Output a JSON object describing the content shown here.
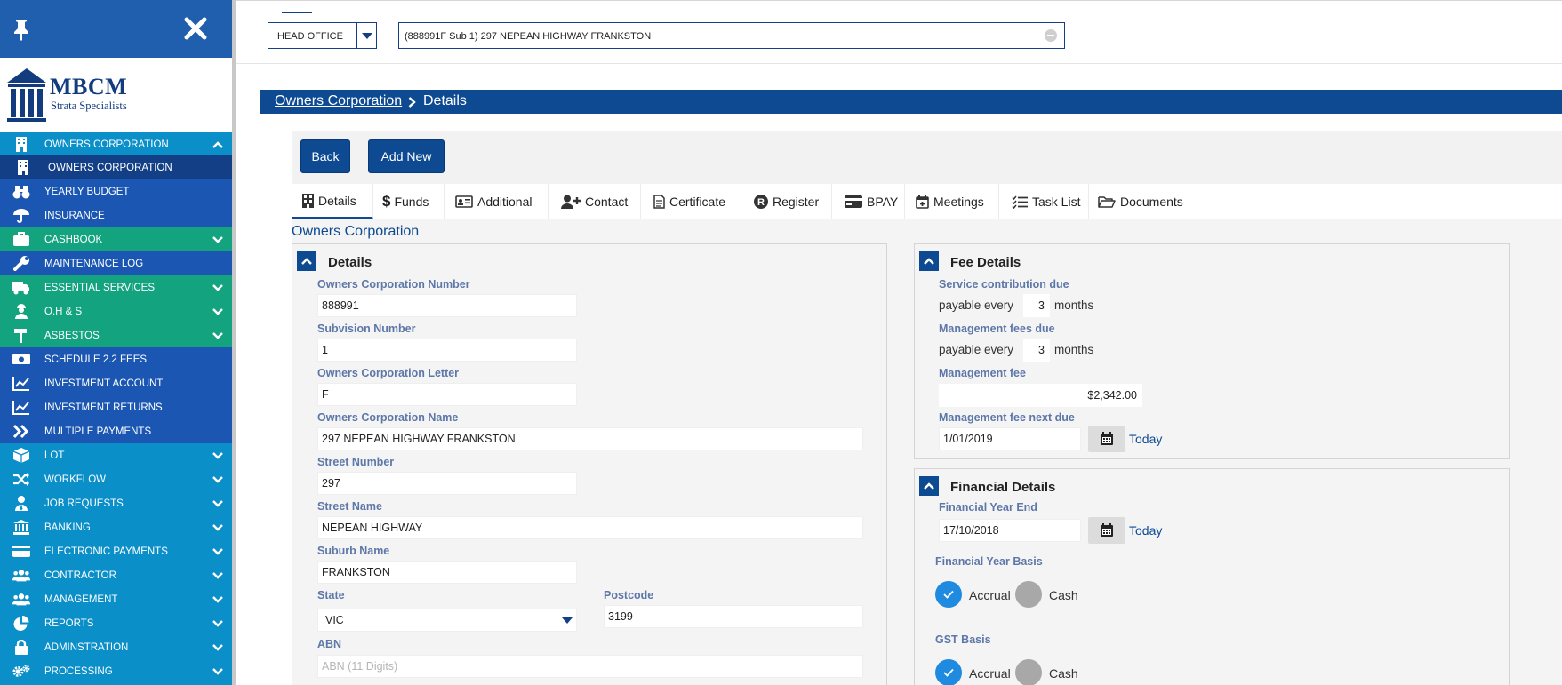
{
  "sidebar": {
    "logo_title": "MBCM",
    "logo_subtitle": "Strata Specialists",
    "items": [
      {
        "label": "OWNERS CORPORATION",
        "icon": "building-icon"
      },
      {
        "label": "OWNERS CORPORATION",
        "icon": "building-icon"
      },
      {
        "label": "YEARLY BUDGET",
        "icon": "binoculars-icon"
      },
      {
        "label": "INSURANCE",
        "icon": "umbrella-icon"
      },
      {
        "label": "CASHBOOK",
        "icon": "briefcase-icon"
      },
      {
        "label": "MAINTENANCE LOG",
        "icon": "wrench-icon"
      },
      {
        "label": "ESSENTIAL SERVICES",
        "icon": "truck-icon"
      },
      {
        "label": "O.H & S",
        "icon": "worker-icon"
      },
      {
        "label": "ASBESTOS",
        "icon": "sign-icon"
      },
      {
        "label": "SCHEDULE 2.2 FEES",
        "icon": "money-icon"
      },
      {
        "label": "INVESTMENT ACCOUNT",
        "icon": "chart-line-icon"
      },
      {
        "label": "INVESTMENT RETURNS",
        "icon": "chart-line-icon"
      },
      {
        "label": "MULTIPLE PAYMENTS",
        "icon": "double-chevron-icon"
      },
      {
        "label": "LOT",
        "icon": "cube-icon"
      },
      {
        "label": "WORKFLOW",
        "icon": "shuffle-icon"
      },
      {
        "label": "JOB REQUESTS",
        "icon": "user-tie-icon"
      },
      {
        "label": "BANKING",
        "icon": "bank-icon"
      },
      {
        "label": "ELECTRONIC PAYMENTS",
        "icon": "credit-card-icon"
      },
      {
        "label": "CONTRACTOR",
        "icon": "users-icon"
      },
      {
        "label": "MANAGEMENT",
        "icon": "users-icon"
      },
      {
        "label": "REPORTS",
        "icon": "pie-chart-icon"
      },
      {
        "label": "ADMINSTRATION",
        "icon": "lock-icon"
      },
      {
        "label": "PROCESSING",
        "icon": "cogs-icon"
      }
    ]
  },
  "header": {
    "office": "HEAD OFFICE",
    "selected_oc": "(888991F Sub 1) 297 NEPEAN HIGHWAY FRANKSTON"
  },
  "breadcrumb": {
    "parent": "Owners Corporation",
    "current": "Details"
  },
  "actions": {
    "back": "Back",
    "add_new": "Add New"
  },
  "tabs": [
    "Details",
    "Funds",
    "Additional",
    "Contact",
    "Certificate",
    "Register",
    "BPAY",
    "Meetings",
    "Task List",
    "Documents"
  ],
  "section_heading": "Owners Corporation",
  "details": {
    "title": "Details",
    "oc_number_label": "Owners Corporation Number",
    "oc_number": "888991",
    "subdivision_label": "Subvision Number",
    "subdivision": "1",
    "oc_letter_label": "Owners Corporation Letter",
    "oc_letter": "F",
    "oc_name_label": "Owners Corporation Name",
    "oc_name": "297 NEPEAN HIGHWAY FRANKSTON",
    "street_number_label": "Street Number",
    "street_number": "297",
    "street_name_label": "Street Name",
    "street_name": "NEPEAN HIGHWAY",
    "suburb_label": "Suburb Name",
    "suburb": "FRANKSTON",
    "state_label": "State",
    "state": "VIC",
    "postcode_label": "Postcode",
    "postcode": "3199",
    "abn_label": "ABN",
    "abn_placeholder": "ABN (11 Digits)"
  },
  "fees": {
    "title": "Fee Details",
    "service_due_label": "Service contribution due",
    "payable_every": "payable every",
    "service_months_value": "3",
    "months": "months",
    "mgmt_due_label": "Management fees due",
    "mgmt_months_value": "3",
    "mgmt_fee_label": "Management fee",
    "mgmt_fee": "$2,342.00",
    "mgmt_next_due_label": "Management fee next due",
    "mgmt_next_due": "1/01/2019",
    "today": "Today"
  },
  "financial": {
    "title": "Financial Details",
    "year_end_label": "Financial Year End",
    "year_end": "17/10/2018",
    "today": "Today",
    "fy_basis_label": "Financial Year Basis",
    "gst_basis_label": "GST Basis",
    "accrual": "Accrual",
    "cash": "Cash"
  }
}
